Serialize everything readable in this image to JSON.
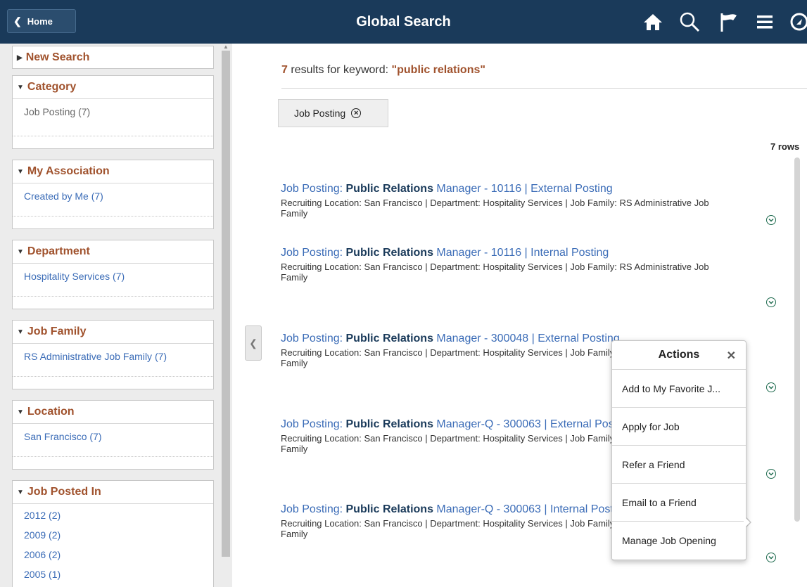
{
  "header": {
    "home_label": "Home",
    "title": "Global Search",
    "icons": [
      "home-icon",
      "search-icon",
      "flag-icon",
      "menu-icon",
      "navbar-icon"
    ]
  },
  "sidebar": {
    "new_search": "New Search",
    "category": {
      "title": "Category",
      "items": [
        "Job Posting (7)"
      ]
    },
    "association": {
      "title": "My Association",
      "items": [
        "Created by Me (7)"
      ]
    },
    "department": {
      "title": "Department",
      "items": [
        "Hospitality Services (7)"
      ]
    },
    "job_family": {
      "title": "Job Family",
      "items": [
        "RS Administrative Job Family (7)"
      ]
    },
    "location": {
      "title": "Location",
      "items": [
        "San Francisco (7)"
      ]
    },
    "posted_in": {
      "title": "Job Posted In",
      "items": [
        "2012 (2)",
        "2009 (2)",
        "2006 (2)",
        "2005 (1)"
      ]
    }
  },
  "main": {
    "result_count": "7",
    "results_text": "results for keyword:",
    "keyword": "\"public relations\"",
    "chip_label": "Job Posting",
    "rows_label": "7 rows",
    "results": [
      {
        "prefix": "Job Posting: ",
        "bold": "Public Relations",
        "suffix": " Manager - 10116 | External Posting",
        "desc": "Recruiting Location: San Francisco | Department: Hospitality Services | Job Family: RS Administrative Job Family"
      },
      {
        "prefix": "Job Posting: ",
        "bold": "Public Relations",
        "suffix": " Manager - 10116 | Internal Posting",
        "desc": "Recruiting Location: San Francisco | Department: Hospitality Services | Job Family: RS Administrative Job Family"
      },
      {
        "prefix": "Job Posting: ",
        "bold": "Public Relations",
        "suffix": " Manager - 300048 | External Posting",
        "desc": "Recruiting Location: San Francisco | Department: Hospitality Services | Job Family: RS Administrative Job Family"
      },
      {
        "prefix": "Job Posting: ",
        "bold": "Public Relations",
        "suffix": " Manager-Q - 300063 | External Posting",
        "desc": "Recruiting Location: San Francisco | Department: Hospitality Services | Job Family: RS Administrative Job Family"
      },
      {
        "prefix": "Job Posting: ",
        "bold": "Public Relations",
        "suffix": " Manager-Q - 300063 | Internal Posting",
        "desc": "Recruiting Location: San Francisco | Department: Hospitality Services | Job Family: RS Administrative Job Family"
      }
    ]
  },
  "actions": {
    "title": "Actions",
    "items": [
      "Add to My Favorite J...",
      "Apply for Job",
      "Refer a Friend",
      "Email to a Friend",
      "Manage Job Opening"
    ]
  },
  "colors": {
    "header_bg": "#1a3a5a",
    "accent": "#a0522d",
    "link": "#3b6cb7"
  }
}
